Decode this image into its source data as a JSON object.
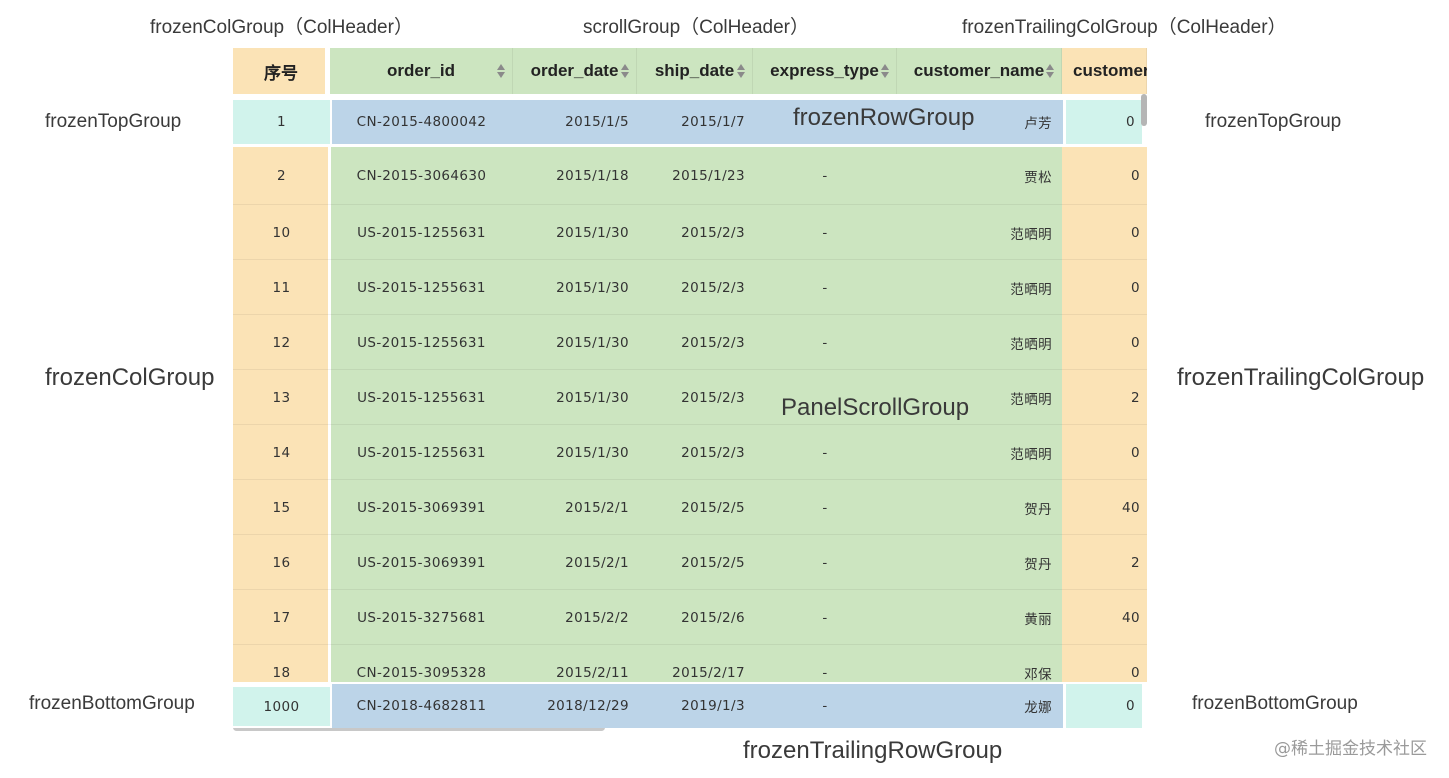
{
  "annotations": {
    "col_header_frozen": "frozenColGroup（ColHeader）",
    "col_header_scroll": "scrollGroup（ColHeader）",
    "col_header_trailing": "frozenTrailingColGroup（ColHeader）",
    "frozen_top_left": "frozenTopGroup",
    "frozen_top_right": "frozenTopGroup",
    "frozen_row": "frozenRowGroup",
    "frozen_col": "frozenColGroup",
    "frozen_trailing_col": "frozenTrailingColGroup",
    "panel_scroll": "PanelScrollGroup",
    "frozen_bottom_left": "frozenBottomGroup",
    "frozen_bottom_right": "frozenBottomGroup",
    "frozen_trailing_row": "frozenTrailingRowGroup"
  },
  "columns": {
    "index": "序号",
    "order_id": "order_id",
    "order_date": "order_date",
    "ship_date": "ship_date",
    "express_type": "express_type",
    "customer_name": "customer_name",
    "customer_trailing": "customer_"
  },
  "frozen_top_row": {
    "idx": "1",
    "order_id": "CN-2015-4800042",
    "order_date": "2015/1/5",
    "ship_date": "2015/1/7",
    "express_type": "",
    "customer_name": "卢芳",
    "trail": "0"
  },
  "rows": [
    {
      "idx": "2",
      "order_id": "CN-2015-3064630",
      "order_date": "2015/1/18",
      "ship_date": "2015/1/23",
      "express_type": "-",
      "customer_name": "贾松",
      "trail": "0"
    },
    {
      "idx": "10",
      "order_id": "US-2015-1255631",
      "order_date": "2015/1/30",
      "ship_date": "2015/2/3",
      "express_type": "-",
      "customer_name": "范晒明",
      "trail": "0"
    },
    {
      "idx": "11",
      "order_id": "US-2015-1255631",
      "order_date": "2015/1/30",
      "ship_date": "2015/2/3",
      "express_type": "-",
      "customer_name": "范晒明",
      "trail": "0"
    },
    {
      "idx": "12",
      "order_id": "US-2015-1255631",
      "order_date": "2015/1/30",
      "ship_date": "2015/2/3",
      "express_type": "-",
      "customer_name": "范晒明",
      "trail": "0"
    },
    {
      "idx": "13",
      "order_id": "US-2015-1255631",
      "order_date": "2015/1/30",
      "ship_date": "2015/2/3",
      "express_type": "",
      "customer_name": "范晒明",
      "trail": "2"
    },
    {
      "idx": "14",
      "order_id": "US-2015-1255631",
      "order_date": "2015/1/30",
      "ship_date": "2015/2/3",
      "express_type": "-",
      "customer_name": "范晒明",
      "trail": "0"
    },
    {
      "idx": "15",
      "order_id": "US-2015-3069391",
      "order_date": "2015/2/1",
      "ship_date": "2015/2/5",
      "express_type": "-",
      "customer_name": "贺丹",
      "trail": "40"
    },
    {
      "idx": "16",
      "order_id": "US-2015-3069391",
      "order_date": "2015/2/1",
      "ship_date": "2015/2/5",
      "express_type": "-",
      "customer_name": "贺丹",
      "trail": "2"
    },
    {
      "idx": "17",
      "order_id": "US-2015-3275681",
      "order_date": "2015/2/2",
      "ship_date": "2015/2/6",
      "express_type": "-",
      "customer_name": "黄丽",
      "trail": "40"
    },
    {
      "idx": "18",
      "order_id": "CN-2015-3095328",
      "order_date": "2015/2/11",
      "ship_date": "2015/2/17",
      "express_type": "-",
      "customer_name": "邓保",
      "trail": "0"
    }
  ],
  "frozen_bottom_row": {
    "idx": "1000",
    "order_id": "CN-2018-4682811",
    "order_date": "2018/12/29",
    "ship_date": "2019/1/3",
    "express_type": "-",
    "customer_name": "龙娜",
    "trail": "0"
  },
  "watermark": "@稀土掘金技术社区",
  "colors": {
    "frozen": "#fbe3b6",
    "scroll": "#cce5c0",
    "frozen_row_edge": "#d1f3ec",
    "frozen_row_center": "#bcd4e8"
  }
}
